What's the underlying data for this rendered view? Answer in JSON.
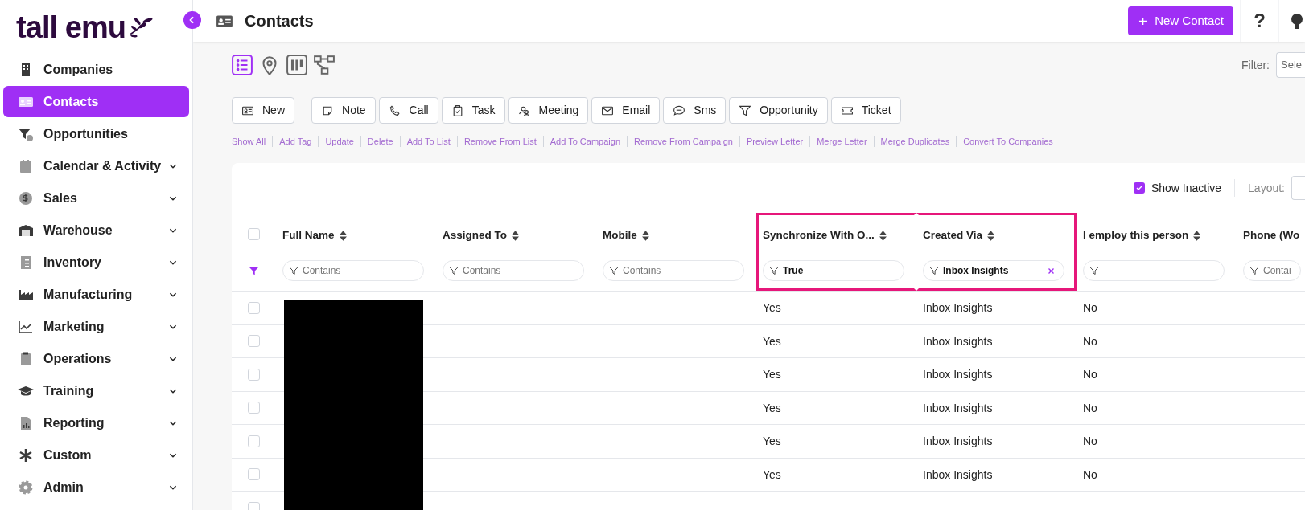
{
  "logo": {
    "text": "tall emu"
  },
  "sidebar": {
    "items": [
      {
        "label": "Companies",
        "selected": false,
        "expandable": false
      },
      {
        "label": "Contacts",
        "selected": true,
        "expandable": false
      },
      {
        "label": "Opportunities",
        "selected": false,
        "expandable": false
      },
      {
        "label": "Calendar & Activity",
        "selected": false,
        "expandable": true
      },
      {
        "label": "Sales",
        "selected": false,
        "expandable": true
      },
      {
        "label": "Warehouse",
        "selected": false,
        "expandable": true
      },
      {
        "label": "Inventory",
        "selected": false,
        "expandable": true
      },
      {
        "label": "Manufacturing",
        "selected": false,
        "expandable": true
      },
      {
        "label": "Marketing",
        "selected": false,
        "expandable": true
      },
      {
        "label": "Operations",
        "selected": false,
        "expandable": true
      },
      {
        "label": "Training",
        "selected": false,
        "expandable": true
      },
      {
        "label": "Reporting",
        "selected": false,
        "expandable": true
      },
      {
        "label": "Custom",
        "selected": false,
        "expandable": true
      },
      {
        "label": "Admin",
        "selected": false,
        "expandable": true
      }
    ]
  },
  "header": {
    "title": "Contacts",
    "primary_button": "New Contact",
    "help": "?"
  },
  "views": [
    {
      "kind": "list",
      "selected": true
    },
    {
      "kind": "map",
      "selected": false
    },
    {
      "kind": "kanban",
      "selected": false
    },
    {
      "kind": "tree",
      "selected": false
    }
  ],
  "filter": {
    "label": "Filter:",
    "placeholder": "Sele"
  },
  "toolbar_buttons": [
    {
      "label": "New",
      "kind": "id-card"
    },
    {
      "label": "Note",
      "kind": "note"
    },
    {
      "label": "Call",
      "kind": "phone"
    },
    {
      "label": "Task",
      "kind": "clipboard"
    },
    {
      "label": "Meeting",
      "kind": "meeting"
    },
    {
      "label": "Email",
      "kind": "envelope"
    },
    {
      "label": "Sms",
      "kind": "chat"
    },
    {
      "label": "Opportunity",
      "kind": "funnel"
    },
    {
      "label": "Ticket",
      "kind": "ticket"
    }
  ],
  "actions": [
    "Show All",
    "Add Tag",
    "Update",
    "Delete",
    "Add To List",
    "Remove From List",
    "Add To Campaign",
    "Remove From Campaign",
    "Preview Letter",
    "Merge Letter",
    "Merge Duplicates",
    "Convert To Companies"
  ],
  "show_inactive": {
    "label": "Show Inactive",
    "checked": true
  },
  "layout": {
    "label": "Layout:"
  },
  "table": {
    "select_all_checked": false,
    "filters_active": true,
    "redacted_name_column": true,
    "columns": [
      {
        "label": "Full Name",
        "highlighted": false,
        "filter": {
          "placeholder": "Contains",
          "clearable": false
        }
      },
      {
        "label": "Assigned To",
        "highlighted": false,
        "filter": {
          "placeholder": "Contains",
          "clearable": false
        }
      },
      {
        "label": "Mobile",
        "highlighted": false,
        "filter": {
          "placeholder": "Contains",
          "clearable": false
        }
      },
      {
        "label": "Synchronize With O...",
        "highlighted": true,
        "filter": {
          "value": "True",
          "clearable": false
        }
      },
      {
        "label": "Created Via",
        "highlighted": true,
        "filter": {
          "value": "Inbox Insights",
          "clearable": true
        }
      },
      {
        "label": "I employ this person",
        "highlighted": false,
        "filter": {
          "clearable": false
        }
      },
      {
        "label": "Phone (Wo",
        "highlighted": false,
        "filter": {
          "placeholder": "Contai",
          "clearable": false
        }
      }
    ],
    "rows": [
      {
        "checked": false,
        "cells": [
          null,
          null,
          null,
          "Yes",
          "Inbox Insights",
          "No",
          null
        ]
      },
      {
        "checked": false,
        "cells": [
          null,
          null,
          null,
          "Yes",
          "Inbox Insights",
          "No",
          null
        ]
      },
      {
        "checked": false,
        "cells": [
          null,
          null,
          null,
          "Yes",
          "Inbox Insights",
          "No",
          null
        ]
      },
      {
        "checked": false,
        "cells": [
          null,
          null,
          null,
          "Yes",
          "Inbox Insights",
          "No",
          null
        ]
      },
      {
        "checked": false,
        "cells": [
          null,
          null,
          null,
          "Yes",
          "Inbox Insights",
          "No",
          null
        ]
      },
      {
        "checked": false,
        "cells": [
          null,
          null,
          null,
          "Yes",
          "Inbox Insights",
          "No",
          null
        ]
      },
      {
        "checked": false,
        "cells": [
          null,
          null,
          null,
          null,
          null,
          null,
          null
        ]
      }
    ]
  }
}
